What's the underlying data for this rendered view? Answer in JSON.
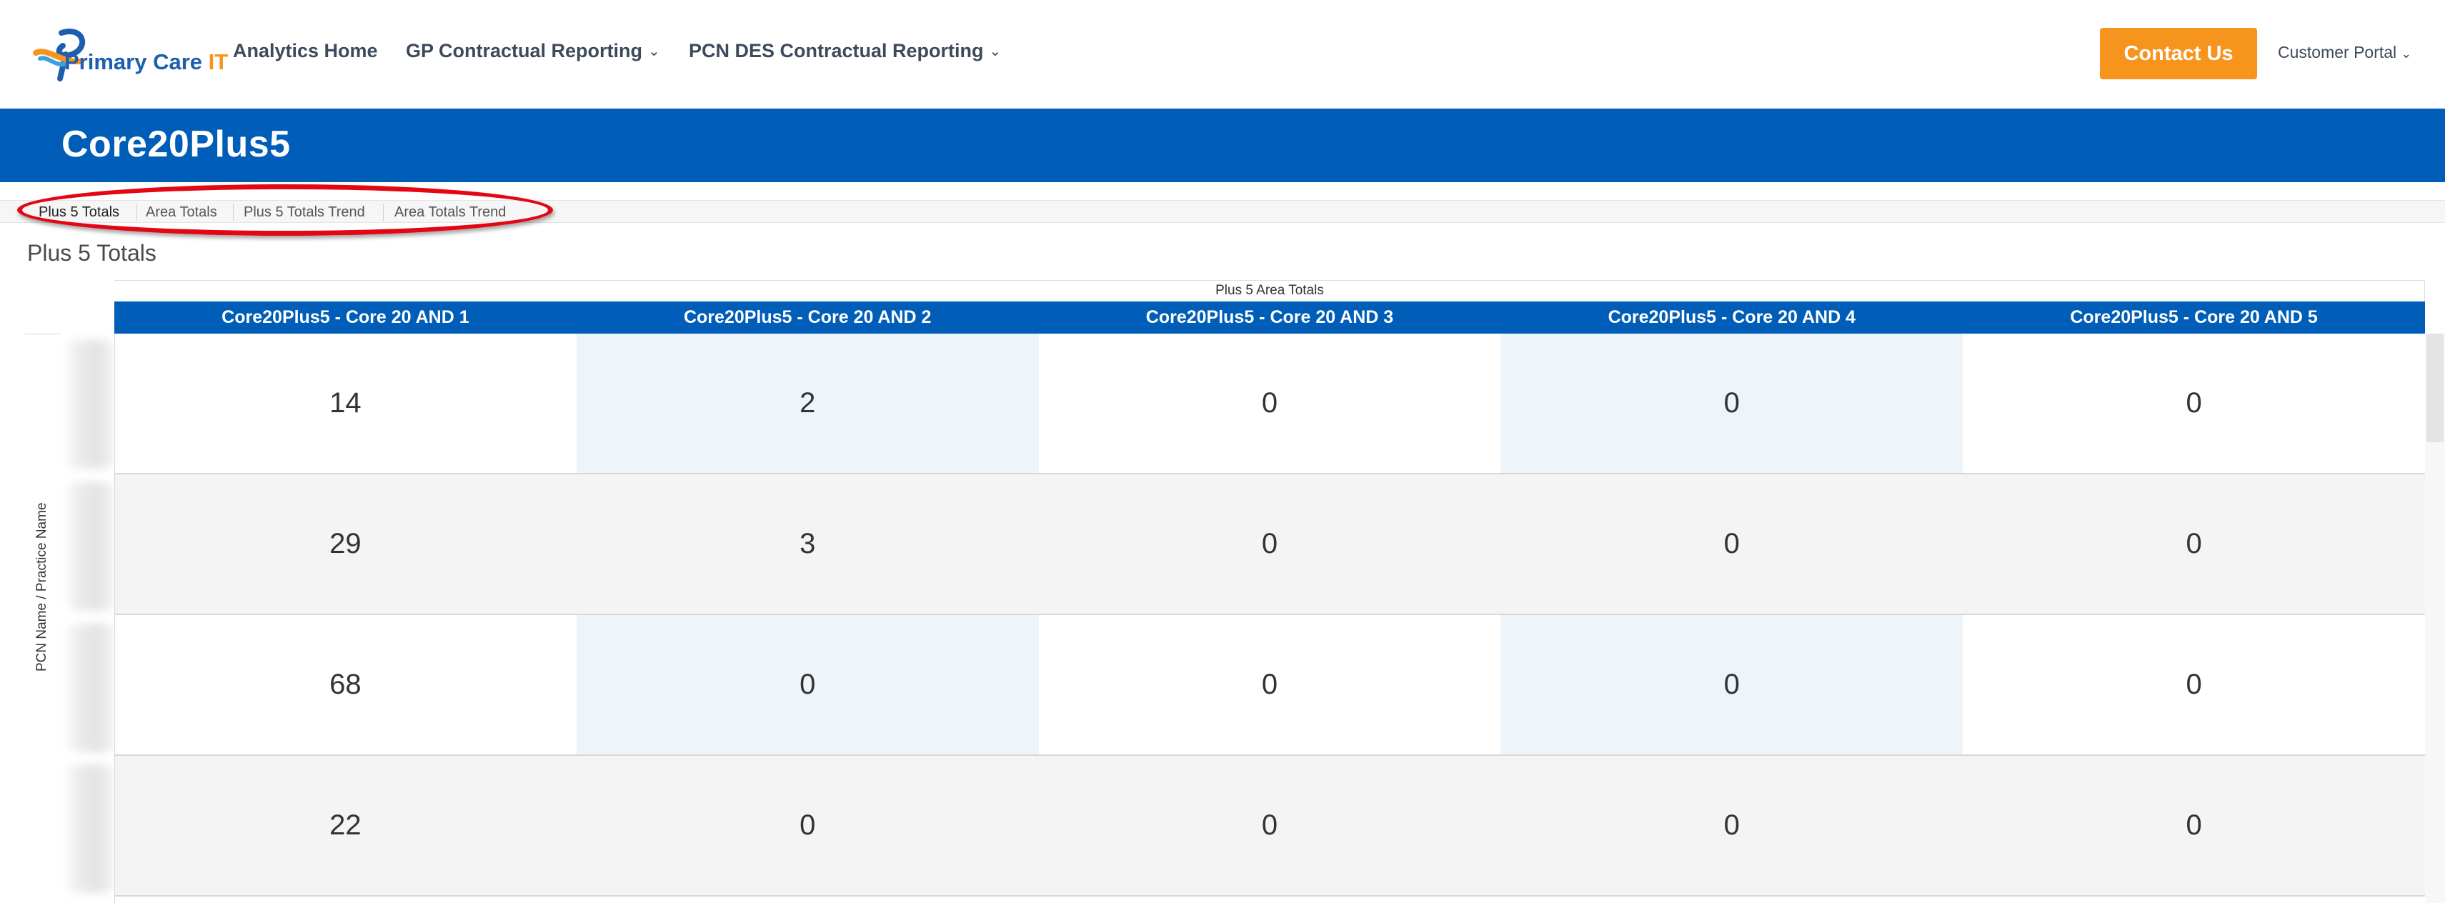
{
  "nav": {
    "logo": {
      "text_part1": "Primary Care",
      "text_part2": "IT"
    },
    "items": [
      {
        "label": "Analytics Home",
        "has_dropdown": false
      },
      {
        "label": "GP Contractual Reporting",
        "has_dropdown": true
      },
      {
        "label": "PCN DES Contractual Reporting",
        "has_dropdown": true
      }
    ],
    "contact_label": "Contact Us",
    "portal_label": "Customer Portal",
    "chevron": "⌄"
  },
  "banner": {
    "title": "Core20Plus5"
  },
  "tabs": [
    {
      "label": "Plus 5 Totals",
      "active": true
    },
    {
      "label": "Area Totals",
      "active": false
    },
    {
      "label": "Plus 5 Totals Trend",
      "active": false
    },
    {
      "label": "Area Totals Trend",
      "active": false
    }
  ],
  "viz": {
    "title": "Plus 5 Totals",
    "column_group_title": "Plus 5 Area Totals",
    "row_axis_label": "PCN Name / Practice Name",
    "columns": [
      "Core20Plus5 - Core 20 AND 1",
      "Core20Plus5 - Core 20 AND 2",
      "Core20Plus5 - Core 20 AND 3",
      "Core20Plus5 - Core 20 AND 4",
      "Core20Plus5 - Core 20 AND 5"
    ],
    "rows": [
      [
        "14",
        "2",
        "0",
        "0",
        "0"
      ],
      [
        "29",
        "3",
        "0",
        "0",
        "0"
      ],
      [
        "68",
        "0",
        "0",
        "0",
        "0"
      ],
      [
        "22",
        "0",
        "0",
        "0",
        "0"
      ]
    ]
  },
  "colors": {
    "brand_blue": "#005eb8",
    "accent_orange": "#f7941d",
    "highlight_red": "#e30613"
  }
}
